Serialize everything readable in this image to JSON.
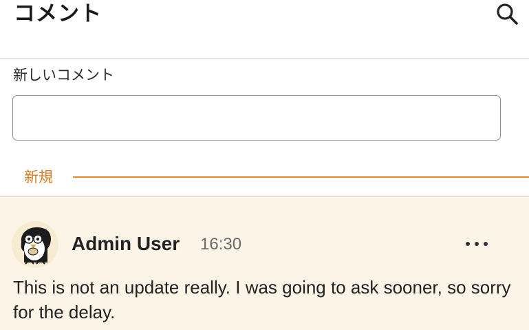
{
  "header": {
    "title": "コメント",
    "search_icon": "search-icon"
  },
  "new_comment": {
    "label": "新しいコメント",
    "input_value": ""
  },
  "divider": {
    "label": "新規",
    "accent_color": "#e98a2a"
  },
  "comment": {
    "author": "Admin User",
    "time": "16:30",
    "body": "This is not an update really. I was going to ask sooner, so sorry for the delay.",
    "more_icon": "more-horizontal-icon",
    "card_background": "#fcf4e6"
  }
}
